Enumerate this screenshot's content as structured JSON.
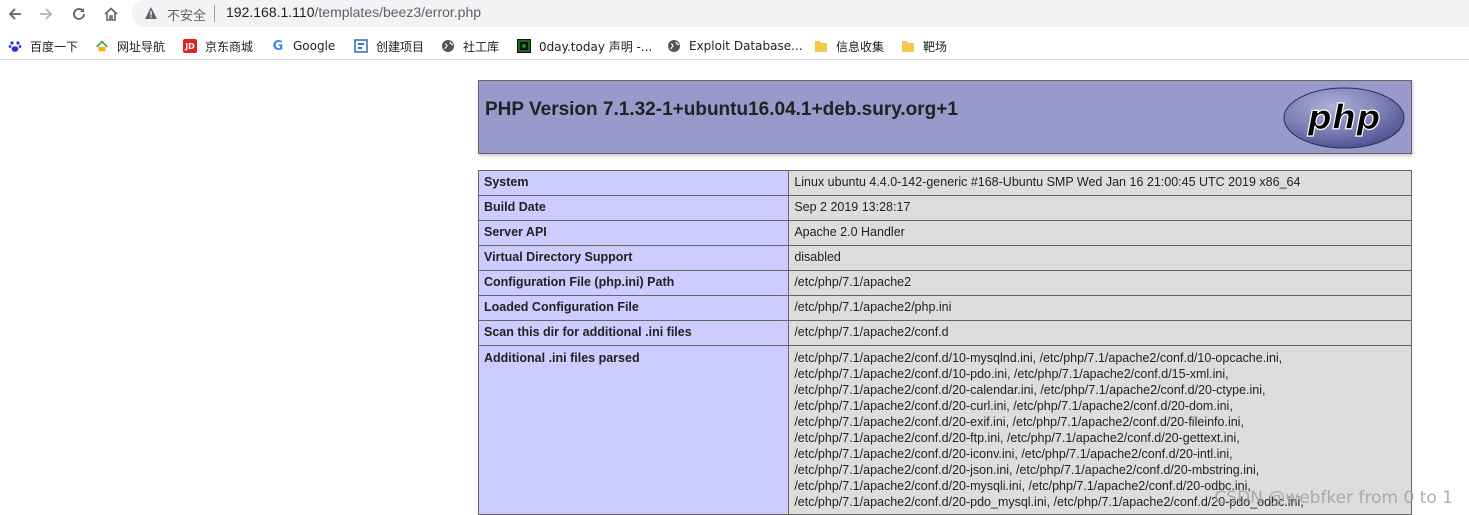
{
  "browser": {
    "insecure_label": "不安全",
    "url_host": "192.168.1.110",
    "url_path": "/templates/beez3/error.php"
  },
  "bookmarks": [
    {
      "label": "百度一下",
      "icon": "baidu-paw-icon",
      "color": "#2932e1"
    },
    {
      "label": "网址导航",
      "icon": "hao-nav-icon",
      "color": "#33a853"
    },
    {
      "label": "京东商城",
      "icon": "jd-icon",
      "color": "#e1251b",
      "glyph": "JD"
    },
    {
      "label": "Google",
      "icon": "google-icon",
      "color": "#4285f4",
      "glyph": "G"
    },
    {
      "label": "创建项目",
      "icon": "project-icon",
      "color": "#3b6fd6"
    },
    {
      "label": "社工库",
      "icon": "globe-icon",
      "color": "#555555"
    },
    {
      "label": "0day.today 声明 -...",
      "icon": "0day-icon",
      "color": "#1a8f1a"
    },
    {
      "label": "Exploit Database...",
      "icon": "globe-icon",
      "color": "#555555"
    },
    {
      "label": "信息收集",
      "icon": "folder-icon",
      "color": "#f2c94c"
    },
    {
      "label": "靶场",
      "icon": "folder-icon",
      "color": "#f2c94c"
    }
  ],
  "php": {
    "title": "PHP Version 7.1.32-1+ubuntu16.04.1+deb.sury.org+1",
    "logo_text": "php",
    "rows": [
      {
        "key": "System",
        "value": "Linux ubuntu 4.4.0-142-generic #168-Ubuntu SMP Wed Jan 16 21:00:45 UTC 2019 x86_64"
      },
      {
        "key": "Build Date",
        "value": "Sep 2 2019 13:28:17"
      },
      {
        "key": "Server API",
        "value": "Apache 2.0 Handler"
      },
      {
        "key": "Virtual Directory Support",
        "value": "disabled"
      },
      {
        "key": "Configuration File (php.ini) Path",
        "value": "/etc/php/7.1/apache2"
      },
      {
        "key": "Loaded Configuration File",
        "value": "/etc/php/7.1/apache2/php.ini"
      },
      {
        "key": "Scan this dir for additional .ini files",
        "value": "/etc/php/7.1/apache2/conf.d"
      }
    ],
    "additional_key": "Additional .ini files parsed",
    "additional_lines": [
      "/etc/php/7.1/apache2/conf.d/10-mysqlnd.ini, /etc/php/7.1/apache2/conf.d/10-opcache.ini,",
      "/etc/php/7.1/apache2/conf.d/10-pdo.ini, /etc/php/7.1/apache2/conf.d/15-xml.ini,",
      "/etc/php/7.1/apache2/conf.d/20-calendar.ini, /etc/php/7.1/apache2/conf.d/20-ctype.ini,",
      "/etc/php/7.1/apache2/conf.d/20-curl.ini, /etc/php/7.1/apache2/conf.d/20-dom.ini,",
      "/etc/php/7.1/apache2/conf.d/20-exif.ini, /etc/php/7.1/apache2/conf.d/20-fileinfo.ini,",
      "/etc/php/7.1/apache2/conf.d/20-ftp.ini, /etc/php/7.1/apache2/conf.d/20-gettext.ini,",
      "/etc/php/7.1/apache2/conf.d/20-iconv.ini, /etc/php/7.1/apache2/conf.d/20-intl.ini,",
      "/etc/php/7.1/apache2/conf.d/20-json.ini, /etc/php/7.1/apache2/conf.d/20-mbstring.ini,",
      "/etc/php/7.1/apache2/conf.d/20-mysqli.ini, /etc/php/7.1/apache2/conf.d/20-odbc.ini,",
      "/etc/php/7.1/apache2/conf.d/20-pdo_mysql.ini, /etc/php/7.1/apache2/conf.d/20-pdo_odbc.ini,"
    ]
  },
  "watermark": "CSDN @webfker from 0 to 1"
}
